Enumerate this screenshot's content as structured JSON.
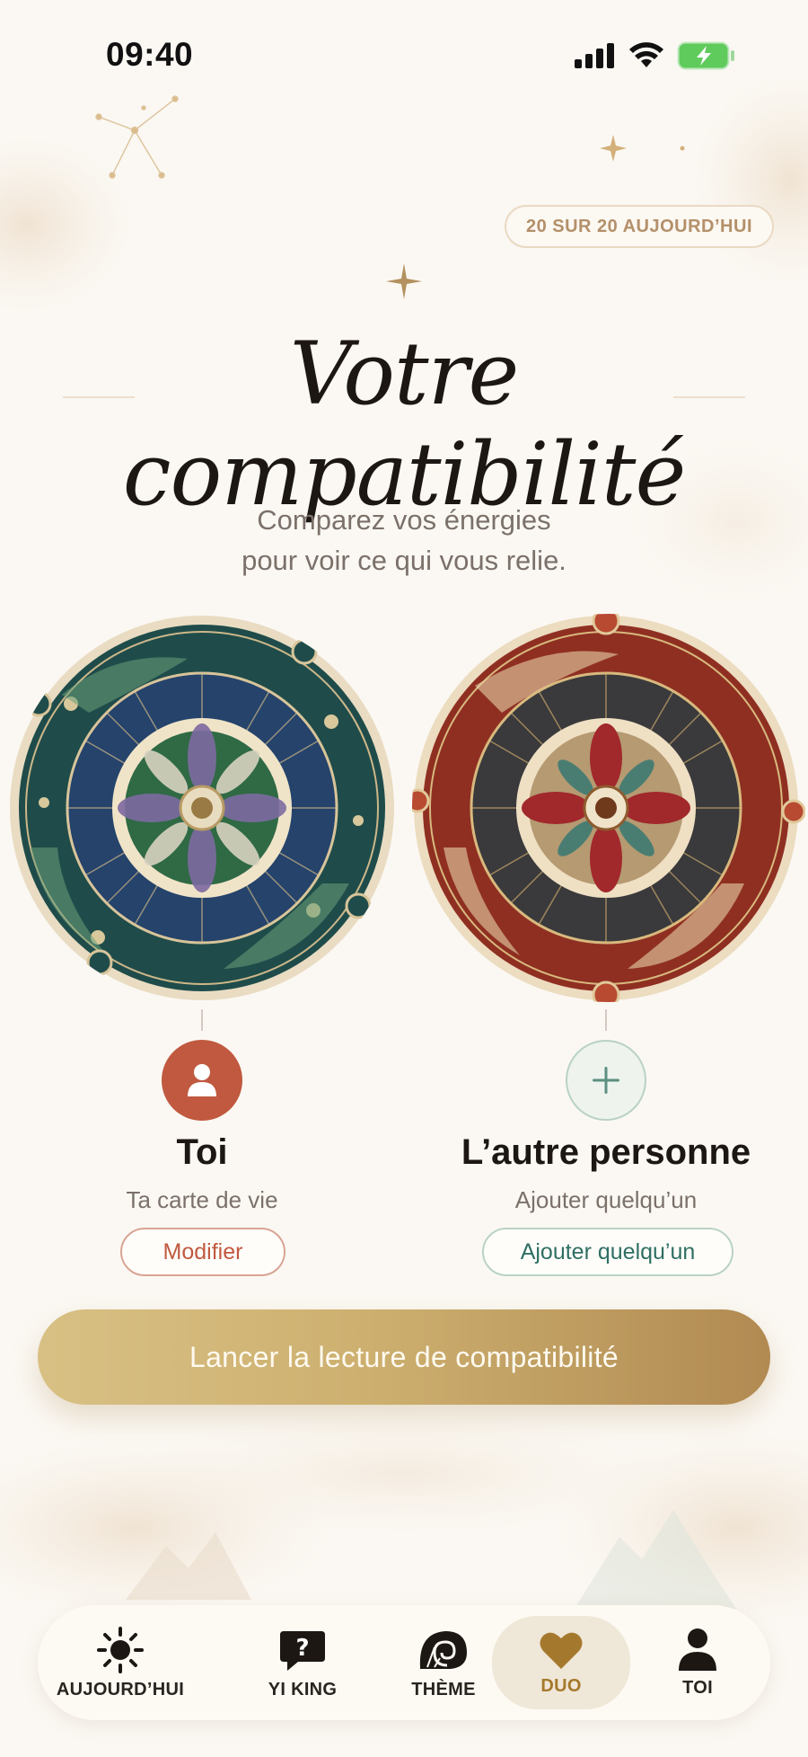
{
  "status_bar": {
    "time": "09:40",
    "icons": [
      "signal-icon",
      "wifi-icon",
      "battery-charging-icon"
    ]
  },
  "quota_badge": "20 SUR 20 AUJOURD’HUI",
  "title": "Votre compatibilité",
  "subtitle_line1": "Comparez vos énergies",
  "subtitle_line2": "pour voir ce qui vous relie.",
  "colors": {
    "accent_gold": "#c9a96a",
    "terracotta": "#c0593f",
    "teal": "#2f6f63",
    "background": "#fbf8f3"
  },
  "person_you": {
    "name": "Toi",
    "subtitle": "Ta carte de vie",
    "button": "Modifier",
    "icon": "person-icon"
  },
  "person_other": {
    "name": "L’autre personne",
    "subtitle": "Ajouter quelqu’un",
    "button": "Ajouter quelqu’un",
    "icon": "plus-icon"
  },
  "cta": "Lancer la lecture de compatibilité",
  "tabs": [
    {
      "label": "AUJOURD’HUI",
      "icon": "sun-icon",
      "active": false
    },
    {
      "label": "YI KING",
      "icon": "question-bubble-icon",
      "active": false
    },
    {
      "label": "THÈME",
      "icon": "shell-icon",
      "active": false
    },
    {
      "label": "DUO",
      "icon": "heart-icon",
      "active": true
    },
    {
      "label": "TOI",
      "icon": "person-icon",
      "active": false
    }
  ]
}
